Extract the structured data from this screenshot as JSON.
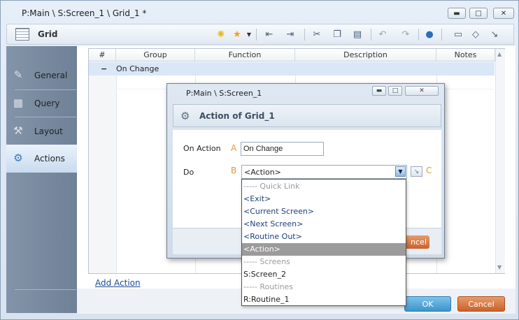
{
  "window": {
    "title": "P:Main \\ S:Screen_1 \\ Grid_1 *",
    "min_glyph": "▬",
    "max_glyph": "□",
    "close_glyph": "✕"
  },
  "toolbar": {
    "label": "Grid",
    "icons": [
      "lightbulb-icon",
      "star-icon",
      "indent-decrease-icon",
      "indent-increase-icon",
      "cut-icon",
      "copy-icon",
      "paste-icon",
      "undo-icon",
      "redo-icon",
      "comment-icon",
      "note-icon",
      "tag-icon",
      "expand-icon"
    ]
  },
  "nav": {
    "items": [
      {
        "label": "General",
        "icon": "pencil-icon"
      },
      {
        "label": "Query",
        "icon": "query-icon"
      },
      {
        "label": "Layout",
        "icon": "wrench-icon"
      },
      {
        "label": "Actions",
        "icon": "gears-icon"
      }
    ],
    "selected": "Actions"
  },
  "grid": {
    "columns": [
      "#",
      "Group",
      "Function",
      "Description",
      "Notes"
    ],
    "group_row": {
      "toggle": "−",
      "name": "On Change"
    },
    "scroll_up": "▲",
    "scroll_down": "▼"
  },
  "add_action_label": "Add Action",
  "buttons": {
    "ok": "OK",
    "cancel": "Cancel"
  },
  "dialog": {
    "title": "P:Main \\ S:Screen_1",
    "header": "Action of Grid_1",
    "on_action_label": "On Action",
    "on_action_value": "On Change",
    "do_label": "Do",
    "do_value": "<Action>",
    "letters": {
      "a": "A",
      "b": "B",
      "c": "C"
    },
    "cancel_peek": "ncel",
    "combo_arrow": "▼",
    "side_glyph": "↘"
  },
  "dropdown": {
    "items": [
      {
        "text": "----- Quick Link",
        "kind": "hdr"
      },
      {
        "text": "<Exit>",
        "kind": "opt"
      },
      {
        "text": "<Current Screen>",
        "kind": "opt"
      },
      {
        "text": "<Next Screen>",
        "kind": "opt"
      },
      {
        "text": "<Routine Out>",
        "kind": "opt"
      },
      {
        "text": "<Action>",
        "kind": "sel"
      },
      {
        "text": "----- Screens",
        "kind": "hdr"
      },
      {
        "text": "S:Screen_2",
        "kind": "plain"
      },
      {
        "text": "----- Routines",
        "kind": "hdr"
      },
      {
        "text": "R:Routine_1",
        "kind": "plain"
      }
    ]
  }
}
